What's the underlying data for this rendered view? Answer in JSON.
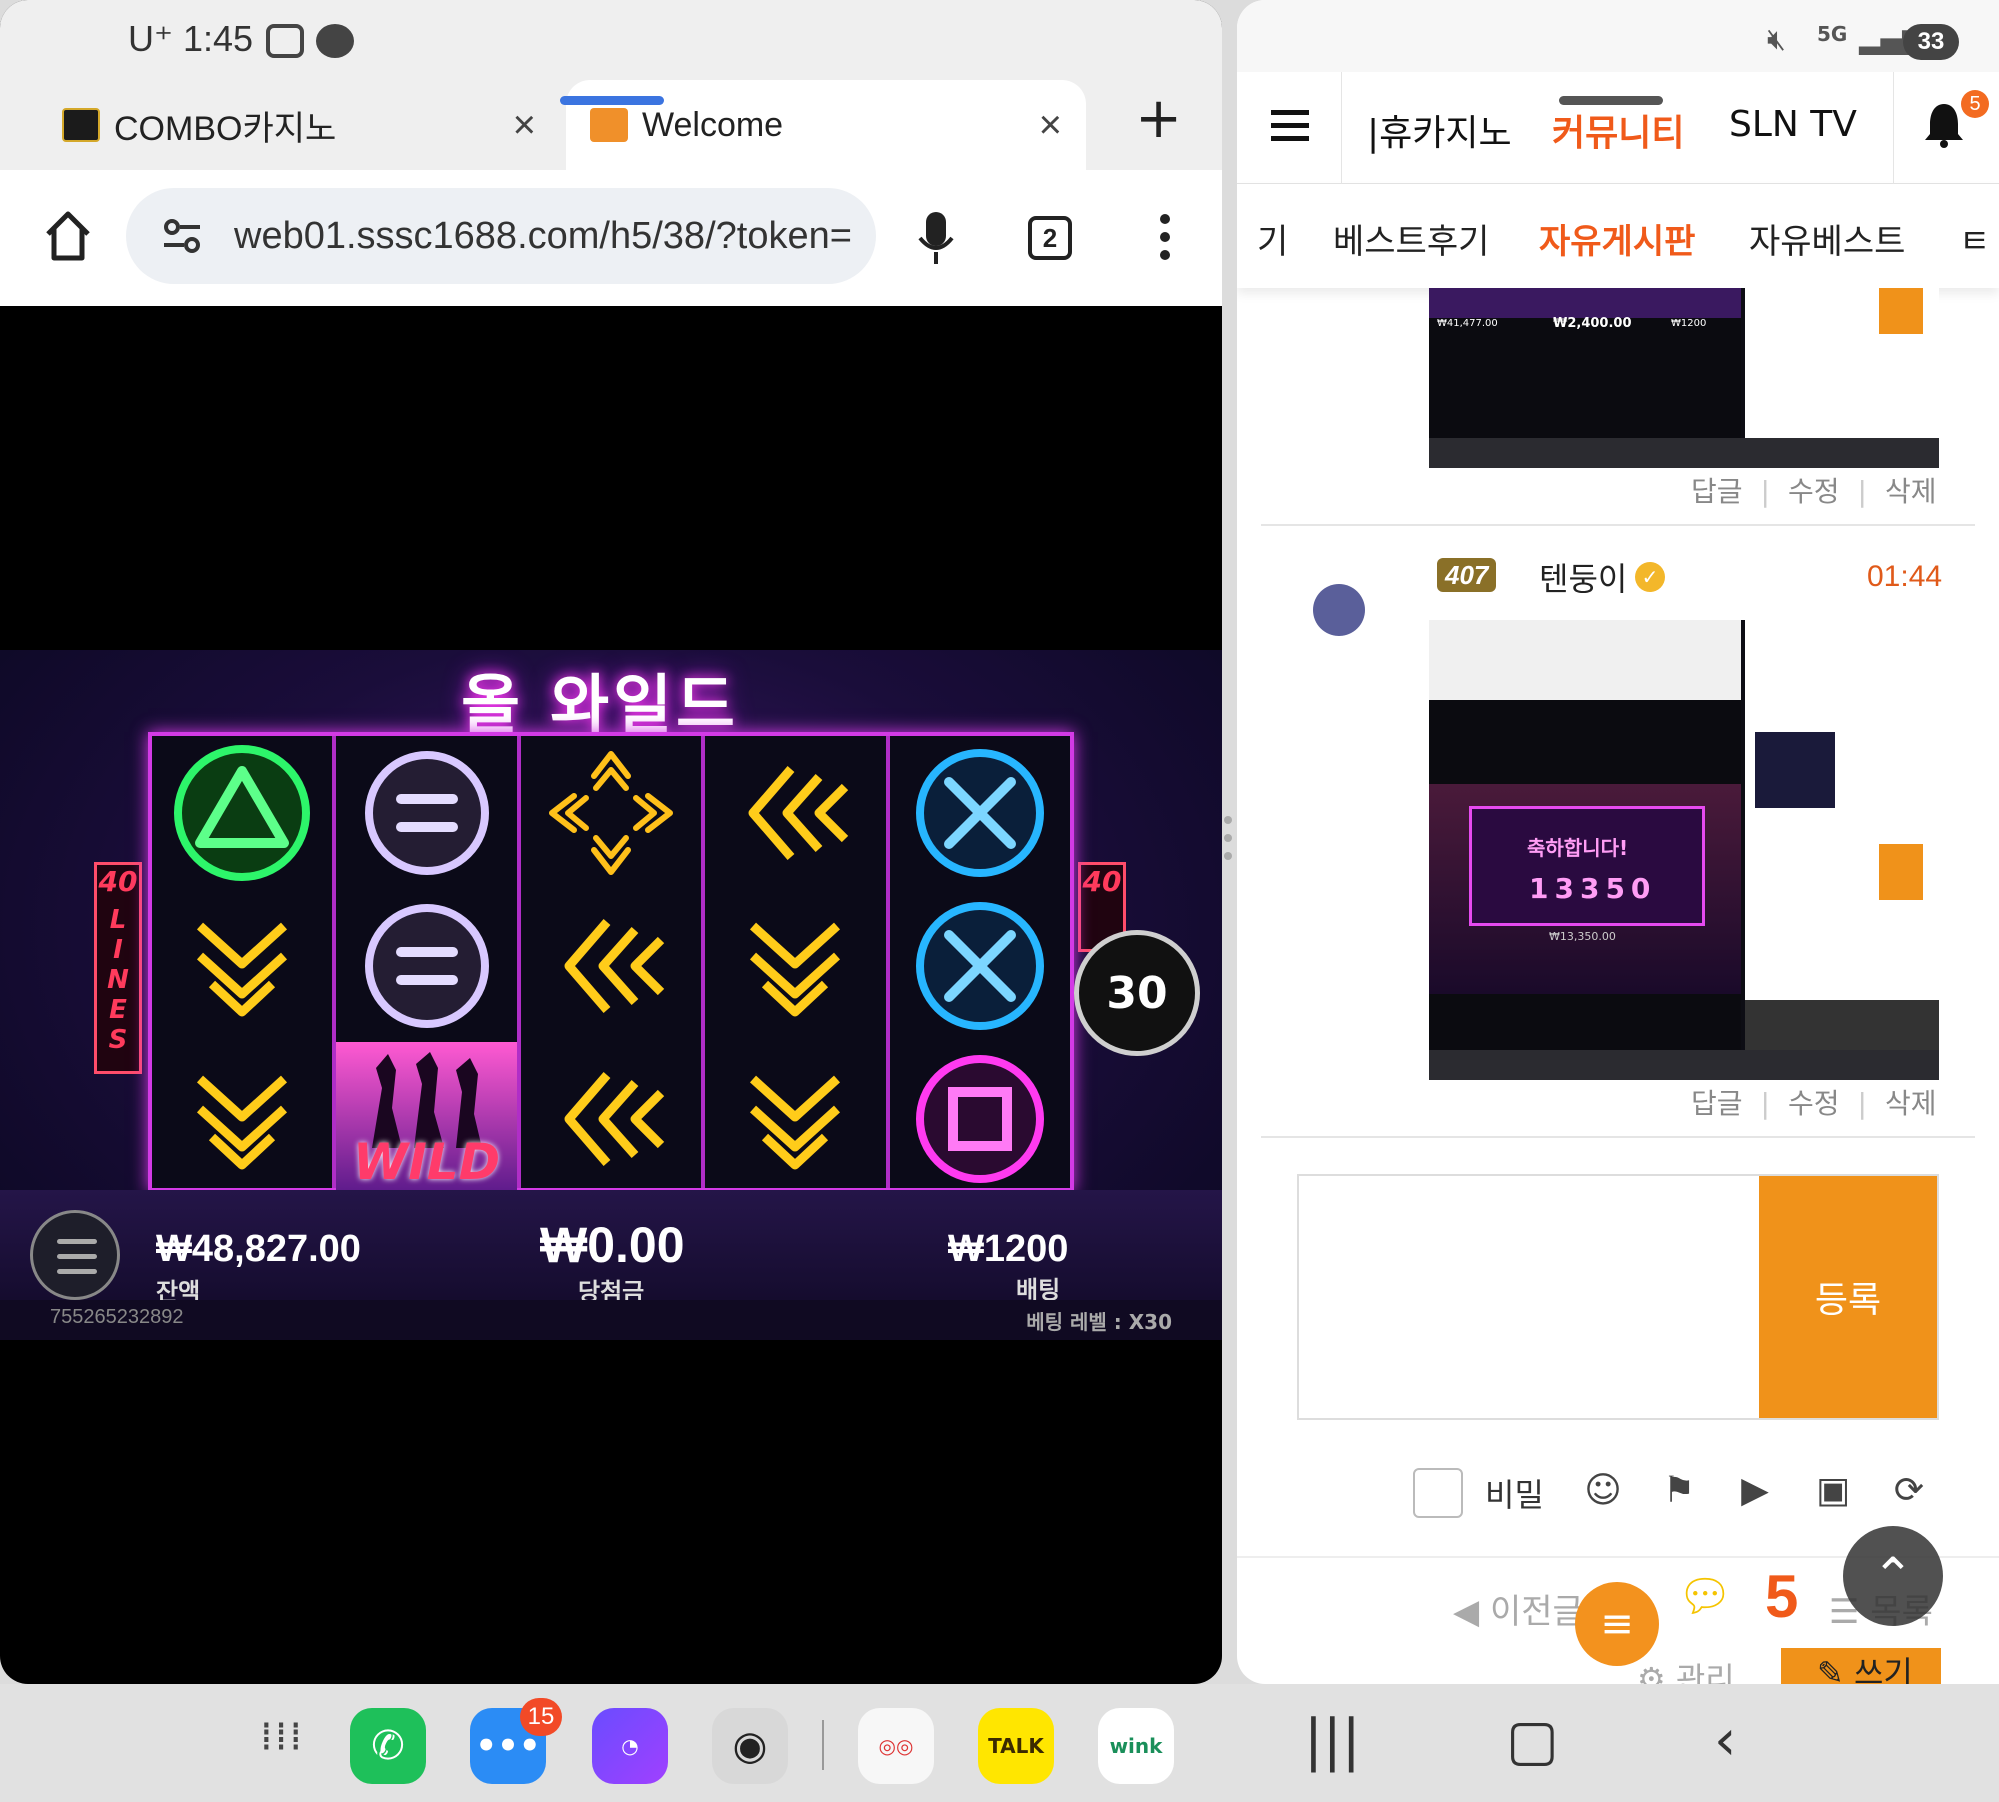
{
  "left_status": {
    "time": "U⁺ 1:45"
  },
  "browser": {
    "tabs": [
      {
        "title": "COMBO카지노",
        "close": "×"
      },
      {
        "title": "Welcome",
        "close": "×"
      }
    ],
    "new_tab": "+",
    "url": "web01.sssc1688.com/h5/38/?token=",
    "tab_count": "2"
  },
  "game": {
    "title": "올 와일드",
    "lines_label": "40 LINES",
    "lines_left": "40",
    "lines_right": "40",
    "spins": "30",
    "balance_value": "₩48,827.00",
    "balance_label": "잔액",
    "win_value": "₩0.00",
    "win_label": "당첨금",
    "bet_value": "₩1200",
    "bet_label": "배팅",
    "game_id": "755265232892",
    "bet_level": "베팅 레벨 : X30",
    "wild_text": "WILD",
    "symbols": [
      [
        "triangle",
        "chevron-down",
        "chevron-down"
      ],
      [
        "equals",
        "equals",
        "wild"
      ],
      [
        "cross-arrows",
        "chevron-left",
        "chevron-left"
      ],
      [
        "chevron-left",
        "chevron-down",
        "chevron-down"
      ],
      [
        "x",
        "x",
        "square"
      ]
    ]
  },
  "right_status": {
    "battery": "33"
  },
  "site_nav": {
    "items": [
      "|휴카지노",
      "커뮤니티",
      "SLN TV"
    ],
    "active": "커뮤니티",
    "bell_count": "5",
    "sub_items": [
      "기",
      "베스트후기",
      "자유게시판",
      "자유베스트",
      "ㅌ"
    ],
    "sub_active": "자유게시판"
  },
  "comments": [
    {
      "thumb_values": {
        "balance": "₩41,477.00",
        "win": "₩2,400.00",
        "bet": "₩1200"
      },
      "actions": [
        "답글",
        "수정",
        "삭제"
      ]
    },
    {
      "level": "407",
      "author": "텐둥이",
      "time": "01:44",
      "thumb_text": {
        "congrats": "축하합니다!",
        "amount": "13350",
        "win": "₩13,350.00"
      },
      "actions": [
        "답글",
        "수정",
        "삭제"
      ]
    }
  ],
  "comment_form": {
    "submit": "등록",
    "secret_label": "비밀"
  },
  "bottom": {
    "prev": "이전글",
    "chat_count": "5",
    "list": "목록",
    "manage": "관리",
    "write": "쓰기"
  },
  "taskbar": {
    "messages_badge": "15",
    "talk": "TALK",
    "wink": "wink"
  },
  "colors": {
    "accent_orange": "#f0921a",
    "active_nav": "#f05a1a",
    "neon_pink": "#d33ae6"
  }
}
